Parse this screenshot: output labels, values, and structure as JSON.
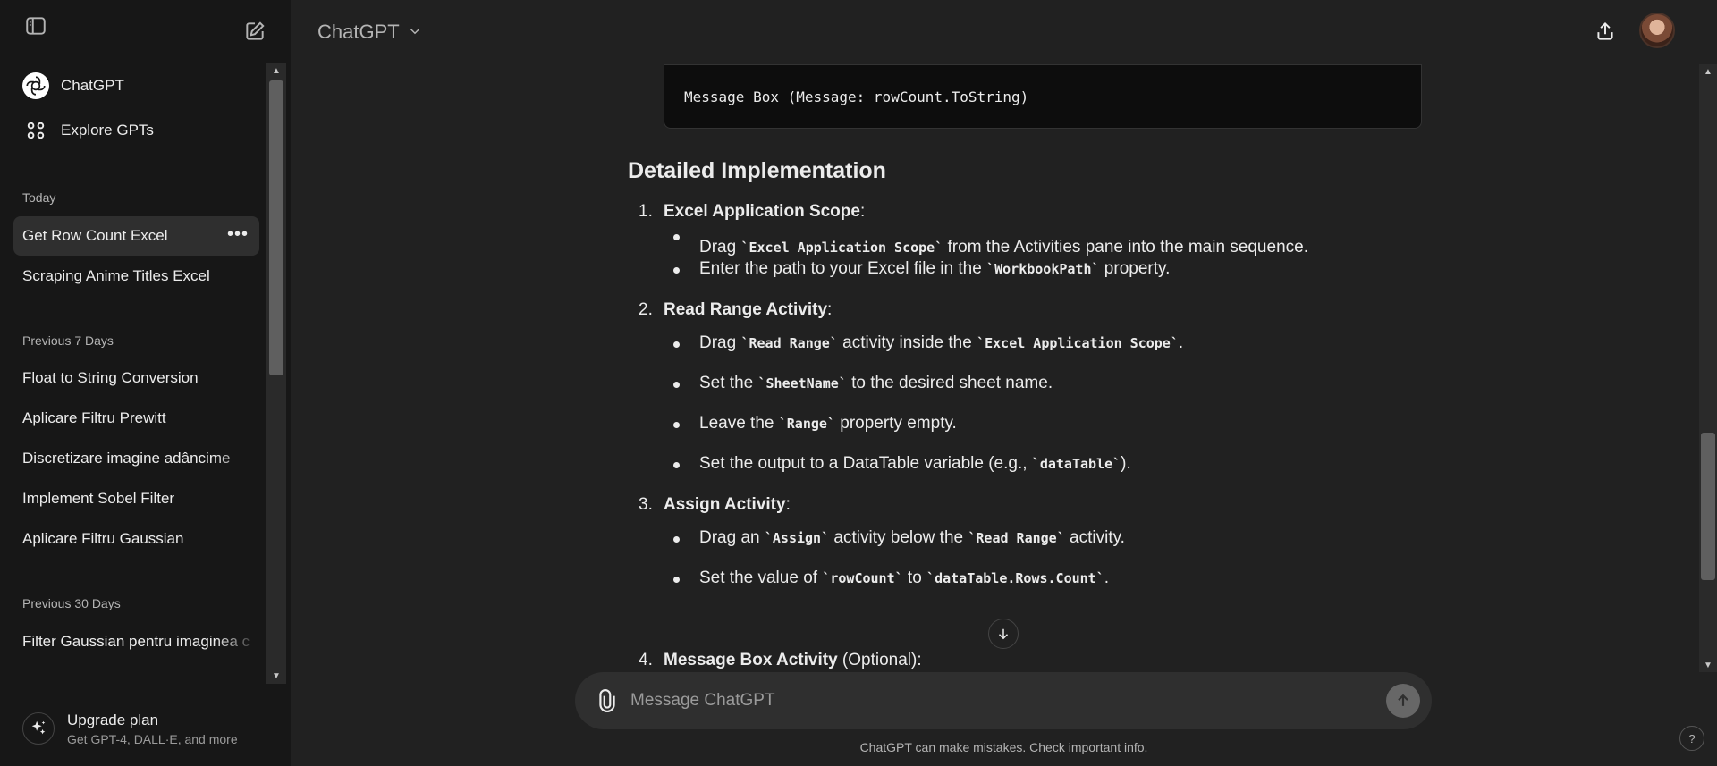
{
  "sidebar": {
    "nav": [
      {
        "label": "ChatGPT",
        "icon": "chatgpt-logo-icon"
      },
      {
        "label": "Explore GPTs",
        "icon": "grid-icon"
      }
    ],
    "sections": [
      {
        "title": "Today",
        "items": [
          "Get Row Count Excel",
          "Scraping Anime Titles Excel"
        ]
      },
      {
        "title": "Previous 7 Days",
        "items": [
          "Float to String Conversion",
          "Aplicare Filtru Prewitt",
          "Discretizare imagine adâncime",
          "Implement Sobel Filter",
          "Aplicare Filtru Gaussian"
        ]
      },
      {
        "title": "Previous 30 Days",
        "items": [
          "Filter Gaussian pentru imaginea c"
        ]
      }
    ],
    "active_item": "Get Row Count Excel",
    "upgrade": {
      "title": "Upgrade plan",
      "subtitle": "Get GPT-4, DALL·E, and more"
    }
  },
  "header": {
    "model": "ChatGPT"
  },
  "conversation": {
    "code_line": "Message Box (Message: rowCount.ToString)",
    "heading": "Detailed Implementation",
    "steps": [
      {
        "num": "1.",
        "title": "Excel Application Scope",
        "suffix": ":"
      },
      {
        "num": "2.",
        "title": "Read Range Activity",
        "suffix": ":"
      },
      {
        "num": "3.",
        "title": "Assign Activity",
        "suffix": ":"
      },
      {
        "num": "4.",
        "title": "Message Box Activity",
        "suffix": " (Optional):"
      }
    ],
    "bullets": {
      "s1b1": {
        "a": "Drag ",
        "c1": "`Excel Application Scope`",
        "b": " from the Activities pane into the main sequence."
      },
      "s1b2": {
        "a": "Enter the path to your Excel file in the ",
        "c1": "`WorkbookPath`",
        "b": " property."
      },
      "s2b1": {
        "a": "Drag ",
        "c1": "`Read Range`",
        "b": " activity inside the ",
        "c2": "`Excel Application Scope`",
        "c": "."
      },
      "s2b2": {
        "a": "Set the ",
        "c1": "`SheetName`",
        "b": " to the desired sheet name."
      },
      "s2b3": {
        "a": "Leave the ",
        "c1": "`Range`",
        "b": " property empty."
      },
      "s2b4": {
        "a": "Set the output to a DataTable variable (e.g., ",
        "c1": "`dataTable`",
        "b": ")."
      },
      "s3b1": {
        "a": "Drag an ",
        "c1": "`Assign`",
        "b": " activity below the ",
        "c2": "`Read Range`",
        "c": " activity."
      },
      "s3b2": {
        "a": "Set the value of ",
        "c1": "`rowCount`",
        "b": " to ",
        "c2": "`dataTable.Rows.Count`",
        "c": "."
      }
    }
  },
  "composer": {
    "placeholder": "Message ChatGPT"
  },
  "disclaimer": "ChatGPT can make mistakes. Check important info.",
  "help": "?",
  "colors": {
    "sidebar_bg": "#171717",
    "main_bg": "#212121",
    "composer_bg": "#2f2f2f",
    "code_bg": "#0d0d0d"
  }
}
